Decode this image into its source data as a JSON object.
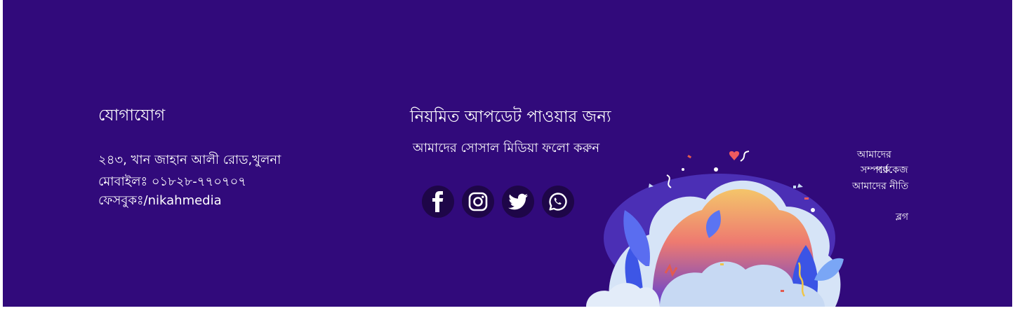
{
  "contact": {
    "title": "যোগাযোগ",
    "address": "২৪৩, খান জাহান আলী রোড,খুলনা",
    "mobile": "মোবাইলঃ ০১৮২৮-৭৭০৭০৭",
    "facebook": "ফেসবুকঃ/nikahmedia"
  },
  "social": {
    "title": "নিয়মিত আপডেট পাওয়ার জন্য",
    "subtitle": "আমাদের সোসাল মিডিয়া ফলো করুন",
    "icons": [
      "facebook-icon",
      "instagram-icon",
      "twitter-icon",
      "whatsapp-icon"
    ]
  },
  "links": {
    "about_line1": "আমাদের",
    "about_line2": "সম্পর্কে",
    "package": "প্যাকেজ",
    "policy": "আমাদের নীতি",
    "blog": "ব্লগ"
  },
  "colors": {
    "background": "#310a7b",
    "icon_circle": "#1e0648",
    "text": "#ffffff"
  }
}
